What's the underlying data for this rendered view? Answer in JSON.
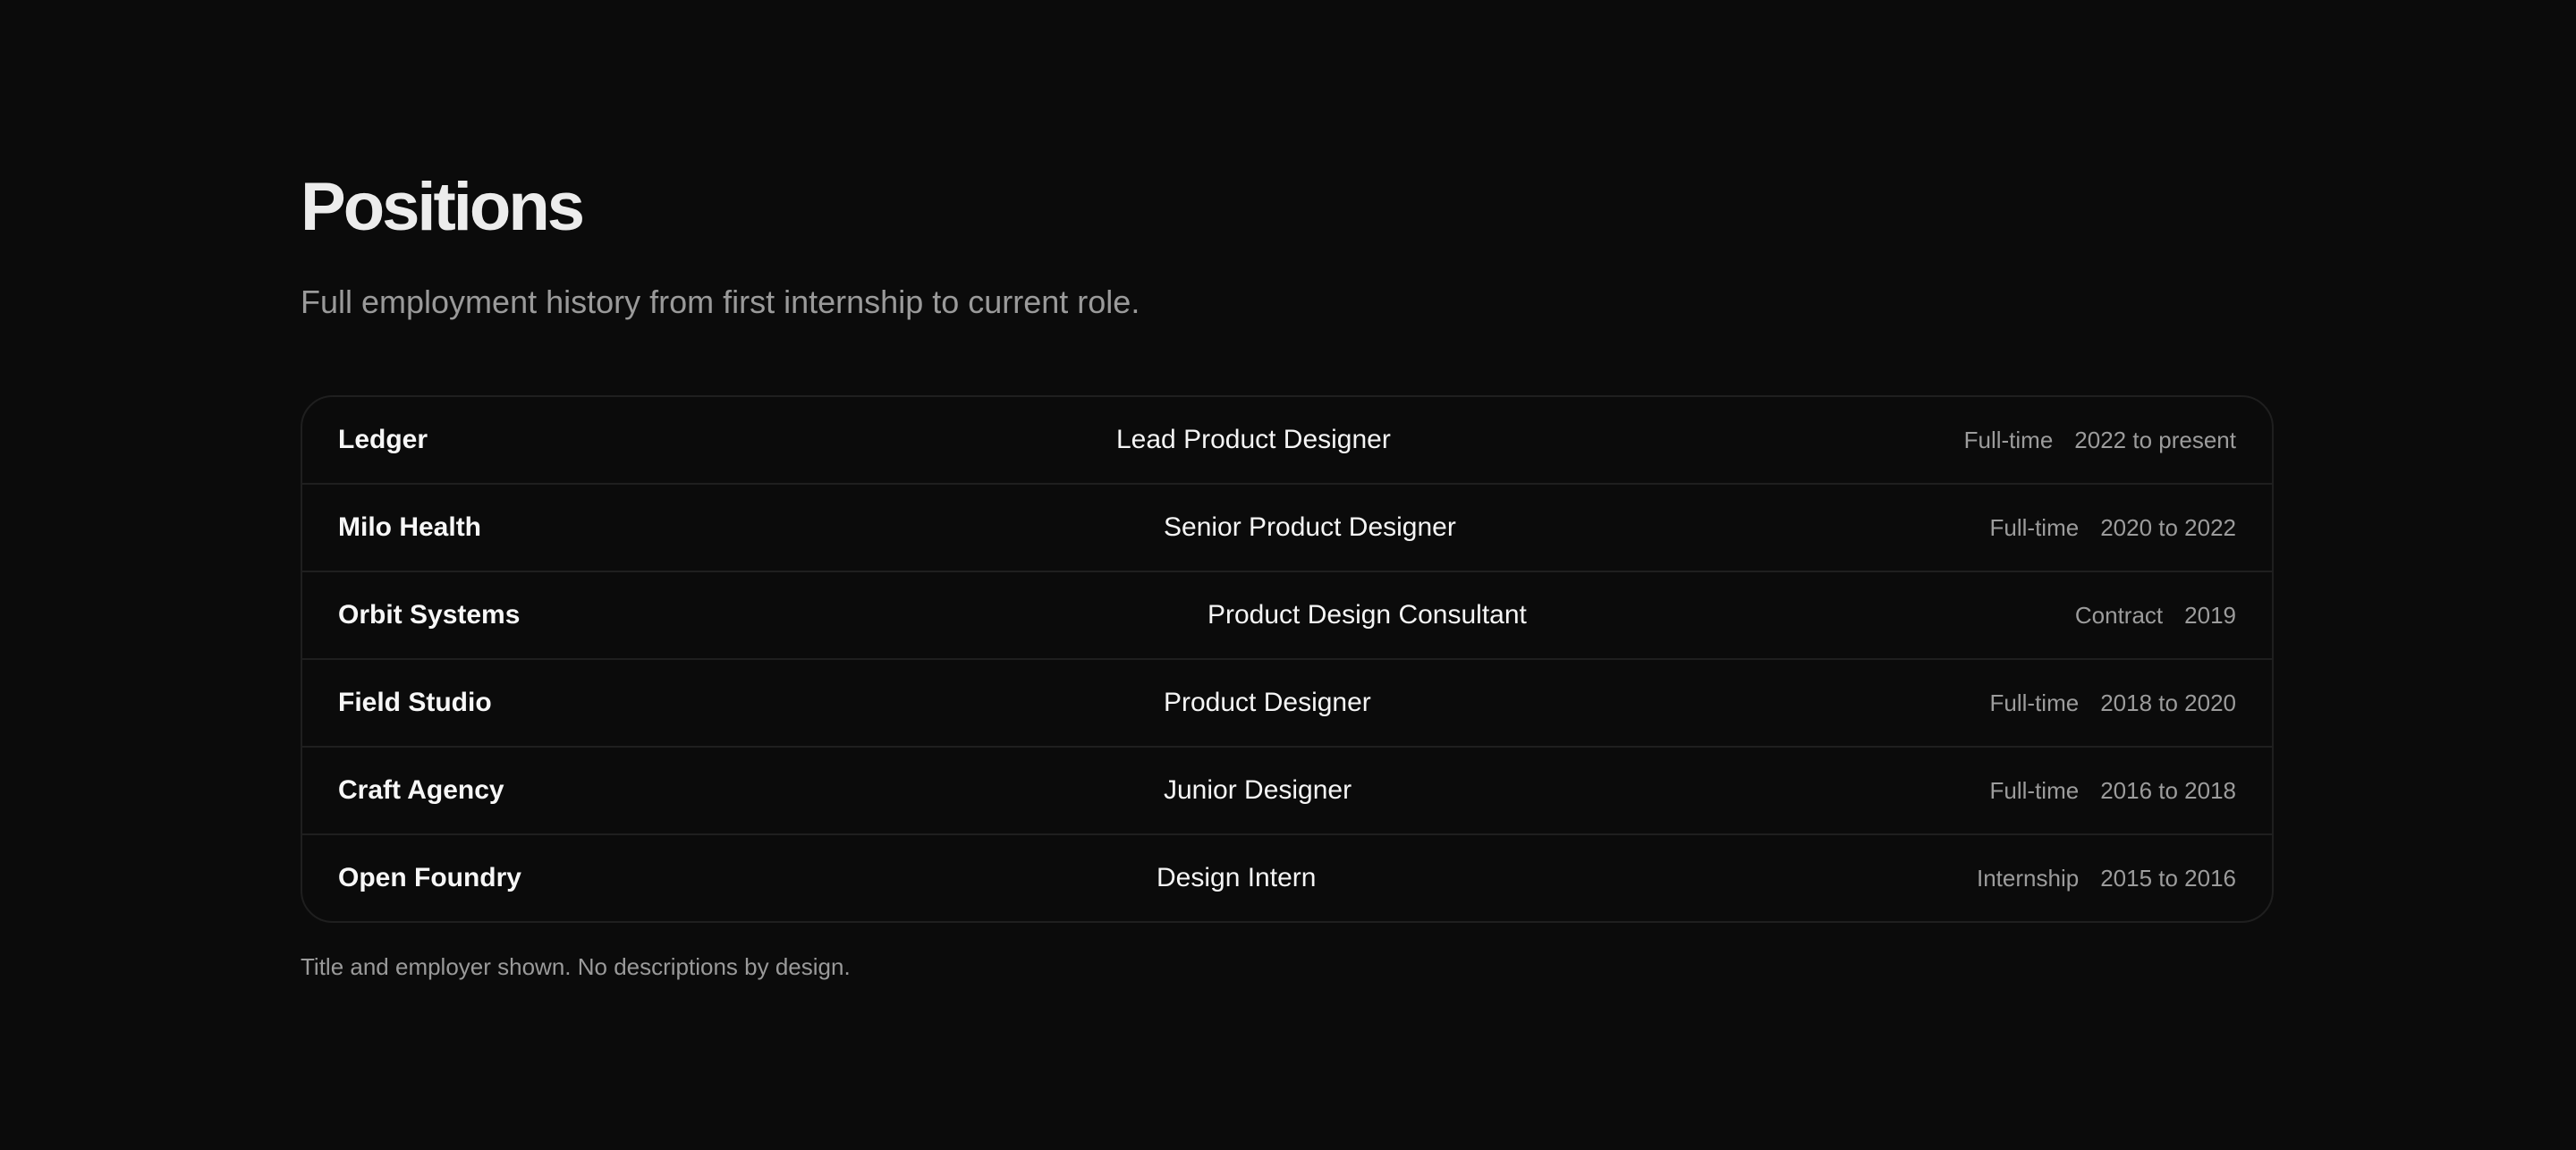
{
  "header": {
    "title": "Positions",
    "subtitle": "Full employment history from first internship to current role."
  },
  "positions": [
    {
      "employer": "Ledger",
      "title": "Lead Product Designer",
      "type": "Full-time",
      "period": "2022 to present"
    },
    {
      "employer": "Milo Health",
      "title": "Senior Product Designer",
      "type": "Full-time",
      "period": "2020 to 2022"
    },
    {
      "employer": "Orbit Systems",
      "title": "Product Design Consultant",
      "type": "Contract",
      "period": "2019"
    },
    {
      "employer": "Field Studio",
      "title": "Product Designer",
      "type": "Full-time",
      "period": "2018 to 2020"
    },
    {
      "employer": "Craft Agency",
      "title": "Junior Designer",
      "type": "Full-time",
      "period": "2016 to 2018"
    },
    {
      "employer": "Open Foundry",
      "title": "Design Intern",
      "type": "Internship",
      "period": "2015 to 2016"
    }
  ],
  "footnote": "Title and employer shown. No descriptions by design."
}
